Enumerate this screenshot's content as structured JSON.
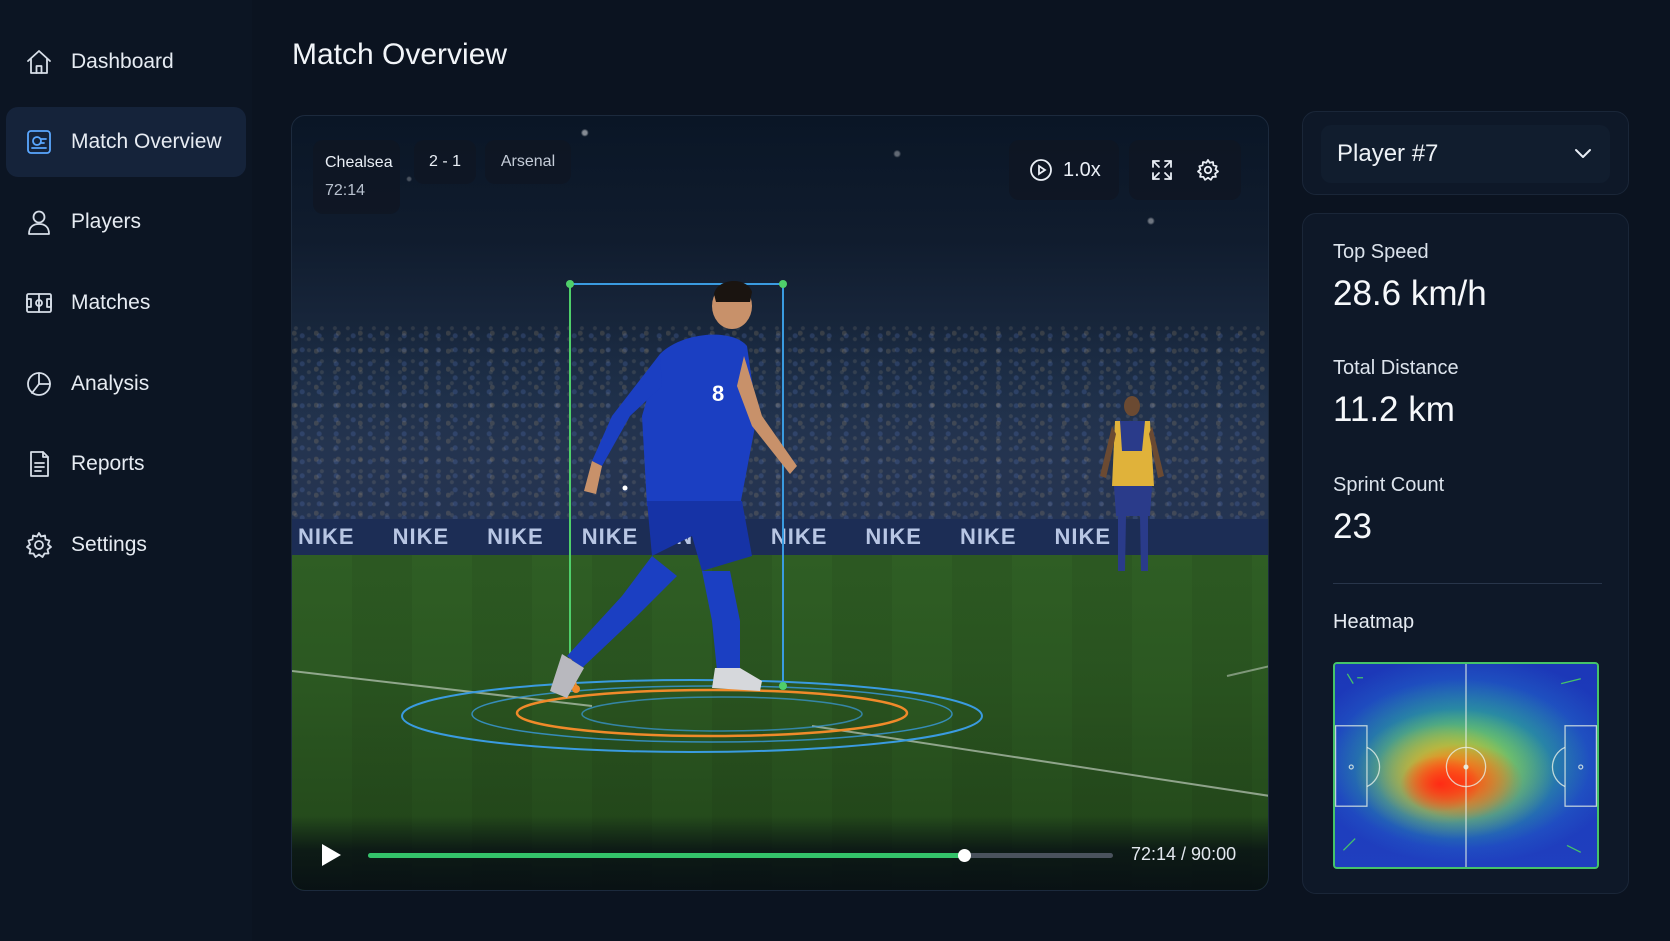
{
  "sidebar": {
    "items": [
      {
        "label": "Dashboard",
        "icon": "home-icon",
        "active": false
      },
      {
        "label": "Match Overview",
        "icon": "match-overview-icon",
        "active": true
      },
      {
        "label": "Players",
        "icon": "user-icon",
        "active": false
      },
      {
        "label": "Matches",
        "icon": "pitch-icon",
        "active": false
      },
      {
        "label": "Analysis",
        "icon": "pie-chart-icon",
        "active": false
      },
      {
        "label": "Reports",
        "icon": "document-icon",
        "active": false
      },
      {
        "label": "Settings",
        "icon": "gear-icon",
        "active": false
      }
    ]
  },
  "header": {
    "title": "Match Overview"
  },
  "video": {
    "home_team": "Chealsea",
    "score": "2 - 1",
    "away_team": "Arsenal",
    "match_clock": "72:14",
    "playback_rate": "1.0x",
    "ad_board_text": [
      "NIKE",
      "NIKE",
      "NIKE",
      "NIKE",
      "NIKE",
      "NIKE",
      "NIKE",
      "NIKE",
      "NIKE"
    ],
    "progress_fraction": 0.8,
    "time_display": "72:14 / 90:00",
    "icons": [
      "play-icon",
      "fullscreen-icon",
      "gear-icon"
    ]
  },
  "player_select": {
    "value": "Player #7",
    "icon": "chevron-down-icon"
  },
  "stats": [
    {
      "label": "Top Speed",
      "value": "28.6 km/h"
    },
    {
      "label": "Total Distance",
      "value": "11.2 km"
    },
    {
      "label": "Sprint Count",
      "value": "23"
    }
  ],
  "heatmap": {
    "label": "Heatmap"
  },
  "colors": {
    "background": "#0b1320",
    "accent_blue": "#5aa7ff",
    "progress_green": "#34c36a",
    "heatmap_border": "#45c36a",
    "tracking_orange": "#f08a2a",
    "tracking_blue": "#3a9be0"
  }
}
